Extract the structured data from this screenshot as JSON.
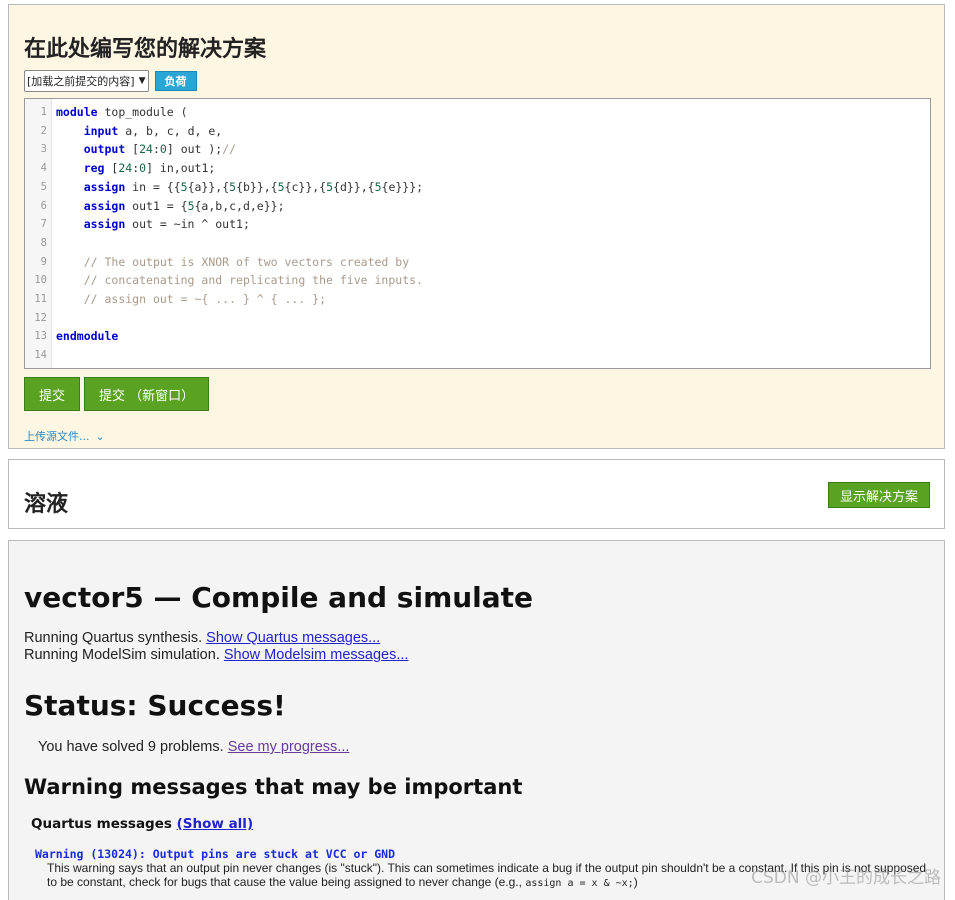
{
  "editor_panel": {
    "title": "在此处编写您的解决方案",
    "load_select_value": "[加载之前提交的内容]",
    "load_button": "负荷",
    "code_lines": [
      {
        "n": "1",
        "html": "<span class=\"kw\">module</span> top_module ("
      },
      {
        "n": "2",
        "html": "    <span class=\"kw\">input</span> a, b, c, d, e,"
      },
      {
        "n": "3",
        "html": "    <span class=\"kw\">output</span> [<span class=\"num\">24</span>:<span class=\"num\">0</span>] out );<span class=\"cm\">//</span>"
      },
      {
        "n": "4",
        "html": "    <span class=\"kw\">reg</span> [<span class=\"num\">24</span>:<span class=\"num\">0</span>] in,out1;"
      },
      {
        "n": "5",
        "html": "    <span class=\"kw\">assign</span> in = {{<span class=\"num\">5</span>{a}},{<span class=\"num\">5</span>{b}},{<span class=\"num\">5</span>{c}},{<span class=\"num\">5</span>{d}},{<span class=\"num\">5</span>{e}}};"
      },
      {
        "n": "6",
        "html": "    <span class=\"kw\">assign</span> out1 = {<span class=\"num\">5</span>{a,b,c,d,e}};"
      },
      {
        "n": "7",
        "html": "    <span class=\"kw\">assign</span> out = ~in ^ out1;"
      },
      {
        "n": "8",
        "html": ""
      },
      {
        "n": "9",
        "html": "    <span class=\"cm\">// The output is XNOR of two vectors created by</span>"
      },
      {
        "n": "10",
        "html": "    <span class=\"cm\">// concatenating and replicating the five inputs.</span>"
      },
      {
        "n": "11",
        "html": "    <span class=\"cm\">// assign out = ~{ ... } ^ { ... };</span>"
      },
      {
        "n": "12",
        "html": ""
      },
      {
        "n": "13",
        "html": "<span class=\"kw\">endmodule</span>"
      },
      {
        "n": "14",
        "html": ""
      }
    ],
    "submit_button": "提交",
    "submit_new_window_button": "提交 （新窗口）",
    "upload_link": "上传源文件...",
    "upload_icon": "double-chevron-down-icon"
  },
  "solution_panel": {
    "title": "溶液",
    "show_solution_button": "显示解决方案"
  },
  "results_panel": {
    "compile_title": "vector5 — Compile and simulate",
    "quartus_line": "Running Quartus synthesis.",
    "quartus_link": "Show Quartus messages...",
    "modelsim_line": "Running ModelSim simulation.",
    "modelsim_link": "Show Modelsim messages...",
    "status_title": "Status: Success!",
    "solved_text": "You have solved 9 problems.",
    "progress_link": "See my progress...",
    "warnings_title": "Warning messages that may be important",
    "quartus_messages_label": "Quartus messages",
    "show_all_link": "(Show all)",
    "warning_title": "Warning (13024): Output pins are stuck at VCC or GND",
    "warning_body_1": "This warning says that an output pin never changes (is \"stuck\"). This can sometimes indicate a bug if the output pin shouldn't be a constant. If this pin is not supposed",
    "warning_body_2": "to be constant, check for bugs that cause the value being assigned to never change (e.g.,",
    "warning_code": "assign a = x & ~x;",
    "warning_body_end": ")"
  },
  "watermark": "CSDN @小王的成长之路"
}
